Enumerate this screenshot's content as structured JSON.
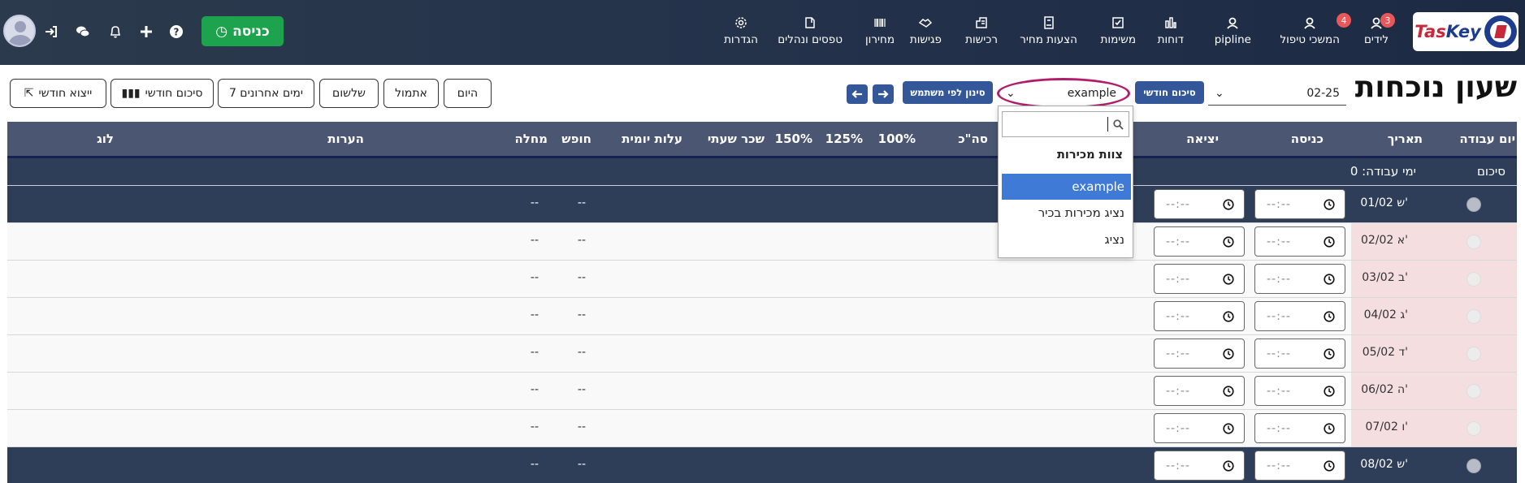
{
  "navbar": {
    "logo_text_red": "Tas",
    "logo_text_blue": "Key",
    "items": [
      {
        "label": "לידים",
        "icon": "user-icon",
        "badge": "3"
      },
      {
        "label": "המשכי טיפול",
        "icon": "user-icon",
        "badge": "4"
      },
      {
        "label": "pipline",
        "icon": "user-icon",
        "badge": ""
      },
      {
        "label": "דוחות",
        "icon": "bar-chart-icon",
        "badge": ""
      },
      {
        "label": "משימות",
        "icon": "checkbox-icon",
        "badge": ""
      },
      {
        "label": "הצעות מחיר",
        "icon": "document-icon",
        "badge": ""
      },
      {
        "label": "רכישות",
        "icon": "purchase-icon",
        "badge": ""
      },
      {
        "label": "פגישות",
        "icon": "handshake-icon",
        "badge": ""
      },
      {
        "label": "מחירון",
        "icon": "barcode-icon",
        "badge": ""
      },
      {
        "label": "טפסים ונהלים",
        "icon": "book-icon",
        "badge": ""
      },
      {
        "label": "הגדרות",
        "icon": "gear-icon",
        "badge": ""
      }
    ],
    "checkin_label": "כניסה"
  },
  "toolbar": {
    "title": "שעון נוכחות",
    "period_value": "02-25",
    "monthly_summary_label": "סיכום חודשי",
    "user_select_value": "example",
    "filter_by_user_label": "סינון לפי משתמש",
    "today_label": "היום",
    "yesterday_label": "אתמול",
    "day_before_label": "שלשום",
    "last7_label": "7 ימים אחרונים",
    "monthly_summary_btn_label": "סיכום חודשי",
    "monthly_export_label": "ייצוא חודשי"
  },
  "table": {
    "headers": {
      "workday": "יום עבודה",
      "date": "תאריך",
      "entry": "כניסה",
      "exit": "יציאה",
      "total": "סה\"כ",
      "p100": "100%",
      "p125": "125%",
      "p150": "150%",
      "hourly_wage": "שכר שעתי",
      "daily_cost": "עלות יומית",
      "vacation": "חופש",
      "sick": "מחלה",
      "notes": "הערות",
      "log": "לוג"
    },
    "summary": {
      "label": "סיכום",
      "workdays": "ימי עבודה: 0"
    },
    "time_placeholder": "--:--",
    "dash": "--",
    "rows": [
      {
        "date": "01/02 ש'",
        "weekend": true
      },
      {
        "date": "02/02 א'",
        "weekend": false
      },
      {
        "date": "03/02 ב'",
        "weekend": false
      },
      {
        "date": "04/02 ג'",
        "weekend": false
      },
      {
        "date": "05/02 ד'",
        "weekend": false
      },
      {
        "date": "06/02 ה'",
        "weekend": false
      },
      {
        "date": "07/02 ו'",
        "weekend": false
      },
      {
        "date": "08/02 ש'",
        "weekend": true
      }
    ]
  },
  "dropdown": {
    "search_value": "",
    "group_label": "צוות מכירות",
    "options": [
      {
        "label": "example",
        "selected": true
      },
      {
        "label": "נציג מכירות בכיר",
        "selected": false
      },
      {
        "label": "נציג",
        "selected": false
      }
    ]
  },
  "colors": {
    "navbar": "#22304a",
    "checkin_green": "#1da34d",
    "accent_blue": "#34579a",
    "table_header": "#4b5673",
    "weekend_row": "#2f3e58",
    "weekday_date_cell": "#f5dedf",
    "highlight_ring": "#b01e6a",
    "selected_option": "#3e7ad6"
  }
}
